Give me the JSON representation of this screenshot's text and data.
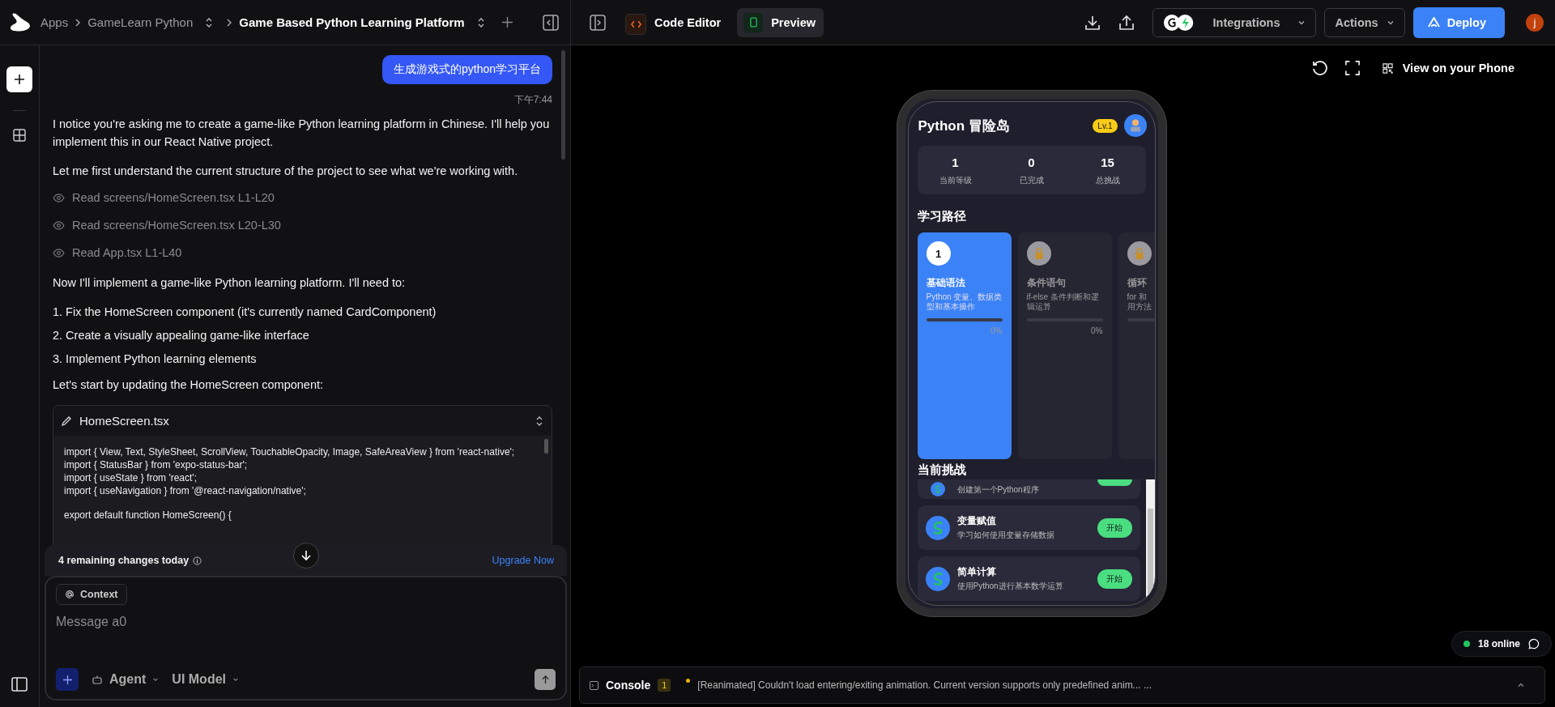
{
  "breadcrumb": [
    {
      "label": "Apps",
      "current": false,
      "switcher": false
    },
    {
      "label": "GameLearn Python",
      "current": false,
      "switcher": true
    },
    {
      "label": "Game Based Python Learning Platform",
      "current": true,
      "switcher": true
    }
  ],
  "chat": {
    "user_message": "生成游戏式的python学习平台",
    "time": "下午7:44",
    "blocks": [
      {
        "kind": "paragraph",
        "text": "I notice you're asking me to create a game-like Python learning platform in Chinese. I'll help you implement this in our React Native project."
      },
      {
        "kind": "paragraph",
        "text": "Let me first understand the current structure of the project to see what we're working with."
      },
      {
        "kind": "read",
        "text": "Read screens/HomeScreen.tsx L1-L20"
      },
      {
        "kind": "read",
        "text": "Read screens/HomeScreen.tsx L20-L30"
      },
      {
        "kind": "read",
        "text": "Read App.tsx L1-L40"
      },
      {
        "kind": "paragraph",
        "text": "Now I'll implement a game-like Python learning platform. I'll need to:"
      },
      {
        "kind": "list_item",
        "text": "1. Fix the HomeScreen component (it's currently named CardComponent)"
      },
      {
        "kind": "list_item",
        "text": "2. Create a visually appealing game-like interface"
      },
      {
        "kind": "list_item",
        "text": "3. Implement Python learning elements"
      },
      {
        "kind": "paragraph",
        "text": "Let's start by updating the HomeScreen component:"
      }
    ],
    "code_block": {
      "filename": "HomeScreen.tsx",
      "groups": [
        [
          "import { View, Text, StyleSheet, ScrollView, TouchableOpacity, Image, SafeAreaView } from 'react-native';",
          "import { StatusBar } from 'expo-status-bar';",
          "import { useState } from 'react';",
          "import { useNavigation } from '@react-navigation/native';"
        ],
        [
          "export default function HomeScreen() {"
        ]
      ]
    }
  },
  "composer": {
    "remaining": "4 remaining changes today",
    "upgrade": "Upgrade Now",
    "context": "Context",
    "placeholder": "Message a0",
    "agent": "Agent",
    "model": "UI Model"
  },
  "toolbar": {
    "tabs": [
      {
        "label": "Code Editor",
        "selected": false
      },
      {
        "label": "Preview",
        "selected": true
      }
    ],
    "integrations": "Integrations",
    "actions": "Actions",
    "deploy": "Deploy",
    "avatar": "j"
  },
  "preview": {
    "view_on_phone": "View on your Phone"
  },
  "phone": {
    "title": "Python 冒险岛",
    "level_badge": "Lv.1",
    "stats": [
      {
        "value": "1",
        "label": "当前等级"
      },
      {
        "value": "0",
        "label": "已完成"
      },
      {
        "value": "15",
        "label": "总挑战"
      }
    ],
    "path_title": "学习路径",
    "lessons": [
      {
        "badge": "1",
        "title": "基础语法",
        "desc": "Python 变量、数据类型和基本操作",
        "percent": "0%",
        "level": 0,
        "selected": true,
        "locked": false
      },
      {
        "title": "条件语句",
        "desc": "if-else 条件判断和逻辑运算",
        "percent": "0%",
        "level": 0,
        "selected": false,
        "locked": true
      },
      {
        "title": "循环",
        "desc": "for 和用方法",
        "level": 0,
        "selected": false,
        "locked": true
      }
    ],
    "challenges_title": "当前挑战",
    "challenges": [
      {
        "desc": "创建第一个Python程序"
      },
      {
        "title": "变量赋值",
        "desc": "学习如何使用变量存储数据",
        "button": "开始"
      },
      {
        "title": "简单计算",
        "desc": "使用Python进行基本数学运算",
        "button": "开始"
      }
    ]
  },
  "console": {
    "title": "Console",
    "count": "1",
    "message": "[Reanimated] Couldn't load entering/exiting animation. Current version supports only predefined anim... ..."
  },
  "online": {
    "label": "18 online"
  }
}
